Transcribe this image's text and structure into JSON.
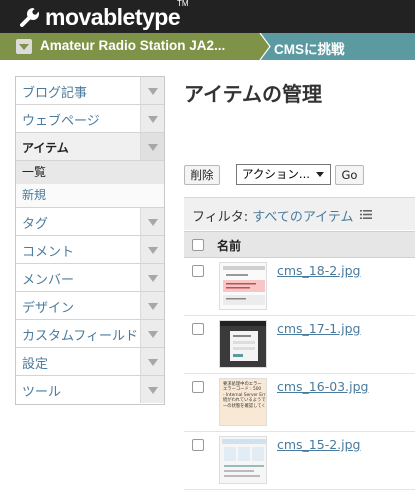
{
  "app": {
    "logo_text": "movabletype",
    "logo_tm": "TM"
  },
  "breadcrumb": {
    "site_name": "Amateur Radio Station JA2...",
    "blog_name": "CMSに挑戦"
  },
  "sidebar": {
    "items": [
      {
        "label": "ブログ記事"
      },
      {
        "label": "ウェブページ"
      },
      {
        "label": "アイテム"
      },
      {
        "label": "タグ"
      },
      {
        "label": "コメント"
      },
      {
        "label": "メンバー"
      },
      {
        "label": "デザイン"
      },
      {
        "label": "カスタムフィールド"
      },
      {
        "label": "設定"
      },
      {
        "label": "ツール"
      }
    ],
    "submenu": [
      {
        "label": "一覧"
      },
      {
        "label": "新規"
      }
    ]
  },
  "main": {
    "title": "アイテムの管理",
    "delete_label": "削除",
    "action_select": "アクション...",
    "go_label": "Go",
    "filter_label": "フィルタ:",
    "filter_value": "すべてのアイテム",
    "column_name": "名前"
  },
  "rows": [
    {
      "file": "cms_18-2.jpg"
    },
    {
      "file": "cms_17-1.jpg"
    },
    {
      "file": "cms_16-03.jpg"
    },
    {
      "file": "cms_15-2.jpg"
    }
  ],
  "thumbnail_texts": {
    "row3_line1": "要求処理中のエラー",
    "row3_line2": "エラーコード : 500",
    "row3_line3": "- Internal Server Err",
    "row3_line4": "続がわれているようで",
    "row3_line5": "一の状態を確認してくだ"
  },
  "colors": {
    "topbar": "#222222",
    "crumb_site": "#7e9347",
    "crumb_blog": "#5b9aa1",
    "link": "#4a7b9d"
  }
}
